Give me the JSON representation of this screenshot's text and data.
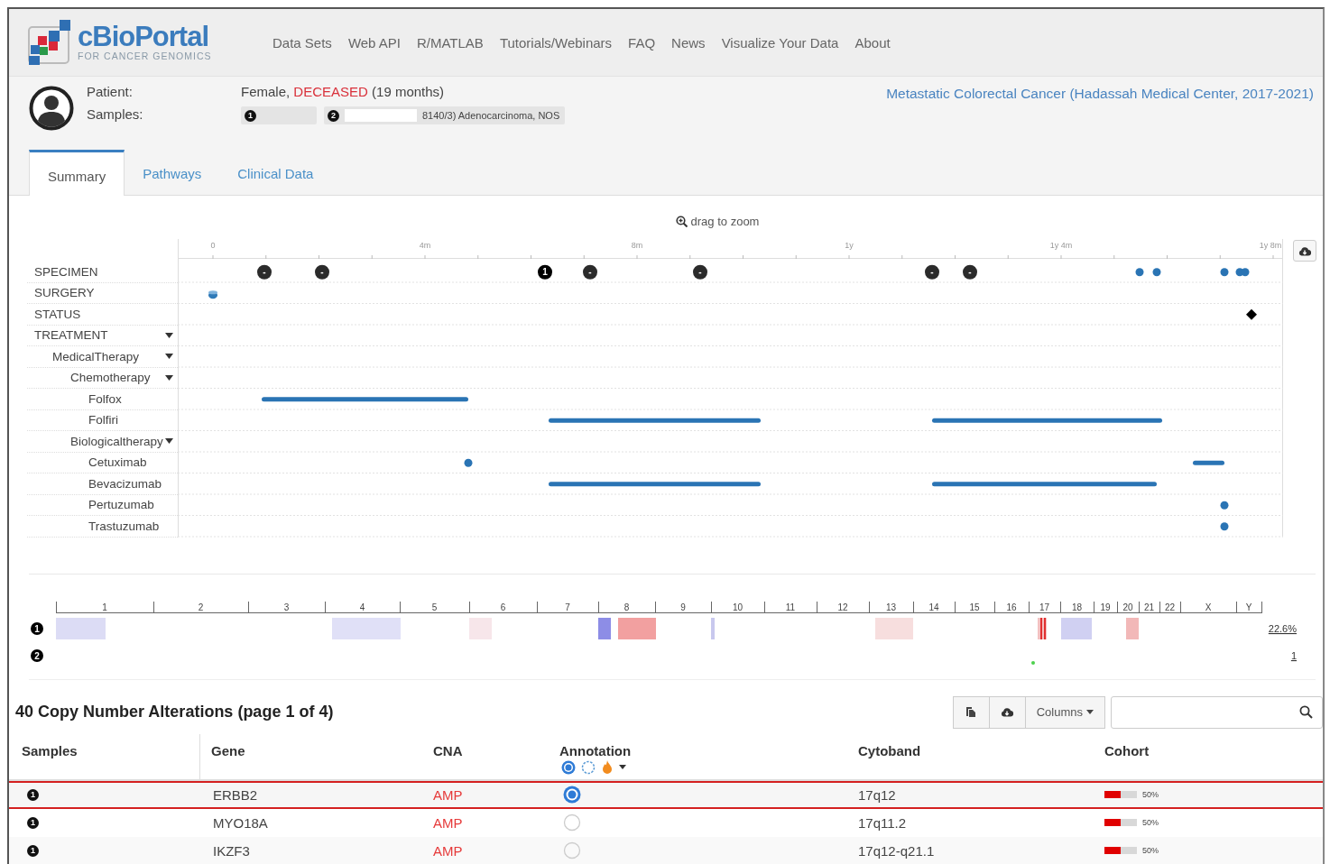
{
  "nav": {
    "logo_title": "cBioPortal",
    "logo_subtitle": "FOR CANCER GENOMICS",
    "links": [
      "Data Sets",
      "Web API",
      "R/MATLAB",
      "Tutorials/Webinars",
      "FAQ",
      "News",
      "Visualize Your Data",
      "About"
    ]
  },
  "patient": {
    "label": "Patient:",
    "sex": "Female,",
    "status": "DECEASED",
    "duration": "(19 months)",
    "samples_label": "Samples:",
    "samples": [
      {
        "number": "1"
      },
      {
        "number": "2",
        "description": "8140/3) Adenocarcinoma, NOS"
      }
    ],
    "study_link": "Metastatic Colorectal Cancer (Hadassah Medical Center, 2017-2021)"
  },
  "tabs": [
    {
      "label": "Summary",
      "selected": true
    },
    {
      "label": "Pathways",
      "selected": false
    },
    {
      "label": "Clinical Data",
      "selected": false
    }
  ],
  "timeline": {
    "hint": "drag to zoom",
    "ticks": [
      "0",
      "4m",
      "8m",
      "1y",
      "1y 4m",
      "1y 8m"
    ],
    "specimen_markers": [
      "-",
      "-",
      "1",
      "-",
      "-",
      "-",
      "-"
    ],
    "tracks": [
      {
        "label": "SPECIMEN"
      },
      {
        "label": "SURGERY"
      },
      {
        "label": "STATUS"
      },
      {
        "label": "TREATMENT",
        "expanded": true,
        "children": [
          {
            "label": "MedicalTherapy",
            "expanded": true,
            "children": [
              {
                "label": "Chemotherapy",
                "expanded": true,
                "children": [
                  {
                    "label": "Folfox"
                  },
                  {
                    "label": "Folfiri"
                  }
                ]
              },
              {
                "label": "Biologicaltherapy",
                "expanded": true,
                "children": [
                  {
                    "label": "Cetuximab"
                  },
                  {
                    "label": "Bevacizumab"
                  },
                  {
                    "label": "Pertuzumab"
                  },
                  {
                    "label": "Trastuzumab"
                  }
                ]
              }
            ]
          }
        ]
      }
    ]
  },
  "genome": {
    "chromosomes": [
      "1",
      "2",
      "3",
      "4",
      "5",
      "6",
      "7",
      "8",
      "9",
      "10",
      "11",
      "12",
      "13",
      "14",
      "15",
      "16",
      "17",
      "18",
      "19",
      "20",
      "21",
      "22",
      "X",
      "Y"
    ],
    "samples": [
      {
        "number": "1",
        "value": "22.6%"
      },
      {
        "number": "2",
        "value": "1"
      }
    ]
  },
  "table": {
    "title": "40 Copy Number Alterations (page 1 of 4)",
    "columns_button": "Columns",
    "columns": [
      "Samples",
      "Gene",
      "CNA",
      "Annotation",
      "Cytoband",
      "Cohort"
    ],
    "rows": [
      {
        "sample": "1",
        "gene": "ERBB2",
        "cna": "AMP",
        "annotated": true,
        "cytoband": "17q12",
        "level": 0.5,
        "cohort": "50%",
        "highlighted": true
      },
      {
        "sample": "1",
        "gene": "MYO18A",
        "cna": "AMP",
        "annotated": false,
        "cytoband": "17q11.2",
        "level": 0.5,
        "cohort": "50%",
        "highlighted": false
      },
      {
        "sample": "1",
        "gene": "IKZF3",
        "cna": "AMP",
        "annotated": false,
        "cytoband": "17q12-q21.1",
        "level": 0.5,
        "cohort": "50%",
        "highlighted": false
      }
    ]
  }
}
